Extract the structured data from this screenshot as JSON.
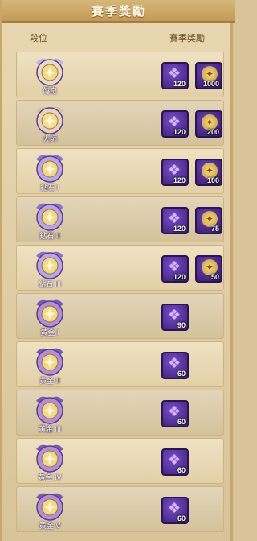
{
  "title": "賽季獎勵",
  "header": {
    "col_rank": "段位",
    "col_reward": "賽季獎勵"
  },
  "rows": [
    {
      "rank": "傳奇",
      "tier": "legend",
      "reward1": "120",
      "reward2": "1000"
    },
    {
      "rank": "大師",
      "tier": "master",
      "reward1": "120",
      "reward2": "200"
    },
    {
      "rank": "鉆石 I",
      "tier": "diamond",
      "reward1": "120",
      "reward2": "100"
    },
    {
      "rank": "鉆石 II",
      "tier": "diamond",
      "reward1": "120",
      "reward2": "75"
    },
    {
      "rank": "鉆石 III",
      "tier": "diamond",
      "reward1": "120",
      "reward2": "50"
    },
    {
      "rank": "黄金 I",
      "tier": "gold",
      "reward1": "90",
      "reward2": null
    },
    {
      "rank": "黄金 II",
      "tier": "gold",
      "reward1": "60",
      "reward2": null
    },
    {
      "rank": "黄金 III",
      "tier": "gold",
      "reward1": "60",
      "reward2": null
    },
    {
      "rank": "黄金 IV",
      "tier": "gold",
      "reward1": "60",
      "reward2": null
    },
    {
      "rank": "黄金 V",
      "tier": "gold",
      "reward1": "60",
      "reward2": null
    }
  ],
  "icons": {
    "reward1": "purple-crystal-icon",
    "reward2": "gold-coin-icon"
  },
  "colors": {
    "accent": "#c29a57",
    "reward_bg": "#4a2a8a",
    "row_bg": "#e8d7b0"
  }
}
